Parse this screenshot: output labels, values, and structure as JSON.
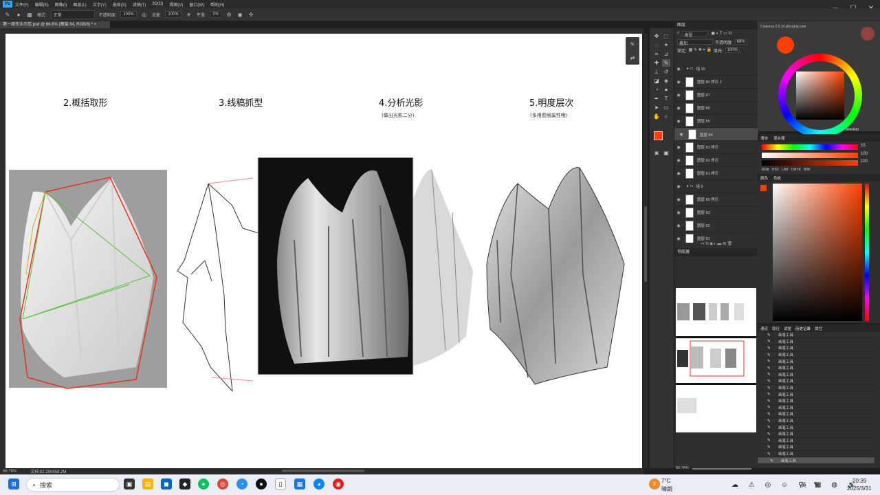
{
  "menubar": {
    "items": [
      "文件(F)",
      "编辑(E)",
      "图像(I)",
      "图层(L)",
      "文字(Y)",
      "选择(S)",
      "滤镜(T)",
      "3D(D)",
      "视图(V)",
      "窗口(W)",
      "帮助(H)"
    ]
  },
  "options": {
    "mode_label": "模式:",
    "mode_value": "正常",
    "opacity_label": "不透明度:",
    "opacity_value": "100%",
    "flow_label": "流量:",
    "flow_value": "100%",
    "smooth_label": "平滑:",
    "smooth_value": "0%"
  },
  "document": {
    "tab_title": "第一周作业示范.psd @ 66.8% (图层 84, RGB/8) *",
    "zoom": "66.78%",
    "doc_size": "文档:82.2M/858.2M"
  },
  "canvas": {
    "headings": [
      "2.概括取形",
      "3.线稿抓型",
      "4.分析光影",
      "5.明度层次"
    ],
    "subtitles": [
      "(做出光影二分)",
      "(多用图层属性哦)"
    ]
  },
  "layers_panel": {
    "title": "图层",
    "filter_label": "类型",
    "blend_mode": "叠加",
    "opacity_label": "不透明度:",
    "opacity_value": "68%",
    "lock_label": "锁定:",
    "fill_label": "填充:",
    "fill_value": "100%",
    "layers": [
      {
        "name": "组 10",
        "group": true
      },
      {
        "name": "图层 80 拷贝 2"
      },
      {
        "name": "图层 87"
      },
      {
        "name": "图层 86"
      },
      {
        "name": "图层 85"
      },
      {
        "name": "图层 84",
        "selected": true
      },
      {
        "name": "图层 83 拷贝"
      },
      {
        "name": "图层 82 拷贝"
      },
      {
        "name": "图层 81 拷贝"
      },
      {
        "name": "组 9",
        "group": true
      },
      {
        "name": "图层 80 拷贝"
      },
      {
        "name": "图层 83"
      },
      {
        "name": "图层 82"
      },
      {
        "name": "图层 81"
      }
    ]
  },
  "navigator": {
    "title": "导航器",
    "zoom": "66.78%"
  },
  "color_panel": {
    "plugin_title": "Coolorus 2.5.14 gfxcamp.com",
    "hex": "#FF400",
    "accent": "#ff4000"
  },
  "swatch_panel": {
    "tabs": [
      "滑块",
      "混合器"
    ],
    "values": [
      "15",
      "100",
      "100"
    ],
    "modes": [
      "RGB",
      "HSV",
      "LAB",
      "CMYK",
      "B/W"
    ]
  },
  "picker_panel": {
    "tabs": [
      "颜色",
      "色板"
    ]
  },
  "history_panel": {
    "tabs": [
      "通道",
      "路径",
      "调整",
      "历史记录",
      "属性"
    ],
    "items": [
      "画笔工具",
      "画笔工具",
      "画笔工具",
      "画笔工具",
      "画笔工具",
      "画笔工具",
      "画笔工具",
      "画笔工具",
      "画笔工具",
      "画笔工具",
      "画笔工具",
      "画笔工具",
      "画笔工具",
      "画笔工具",
      "画笔工具",
      "画笔工具",
      "画笔工具",
      "画笔工具",
      "画笔工具",
      "画笔工具"
    ]
  },
  "taskbar": {
    "search_placeholder": "搜索",
    "weather_badge": "2",
    "temperature": "7°C",
    "weather": "晴朗",
    "ime": "英",
    "time": "20:39",
    "date": "2025/3/31"
  }
}
